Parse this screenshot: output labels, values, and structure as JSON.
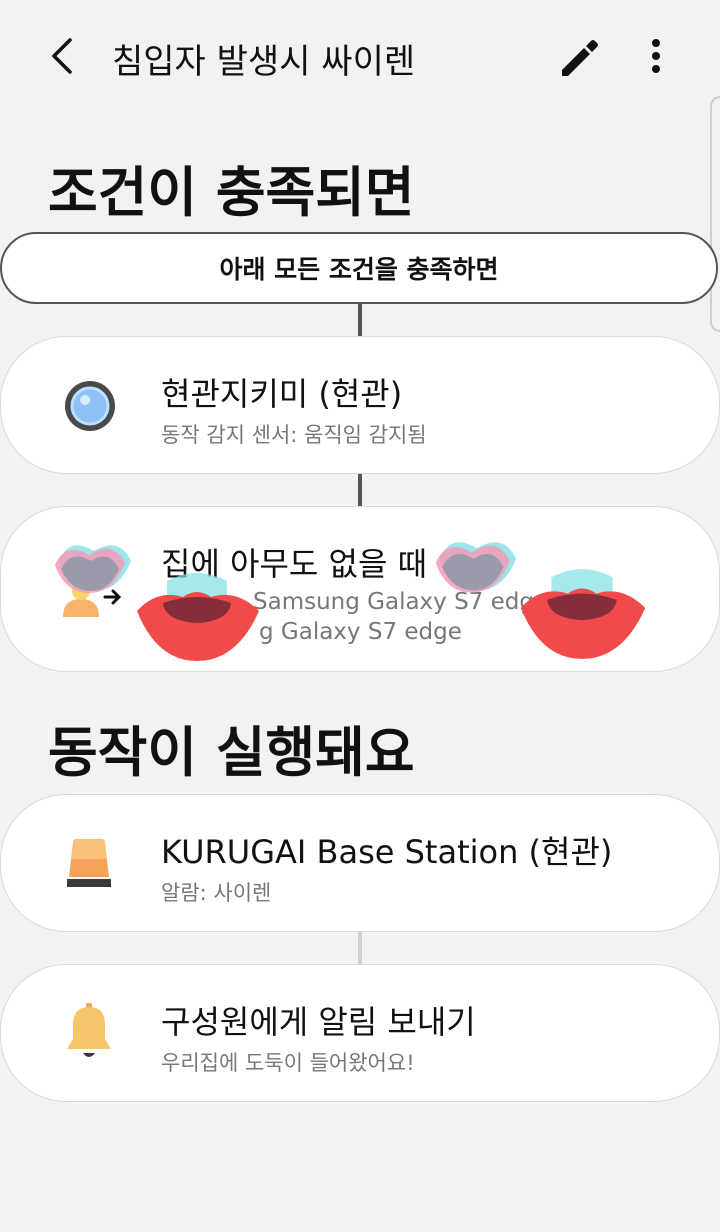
{
  "header": {
    "title": "침입자 발생시 싸이렌",
    "back_icon": "chevron-left-icon",
    "edit_icon": "pencil-icon",
    "more_icon": "more-vertical-icon"
  },
  "conditions": {
    "heading": "조건이 충족되면",
    "match_mode": "아래 모든 조건을 충족하면",
    "items": [
      {
        "title": "현관지키미 (현관)",
        "subtitle": "동작 감지 센서: 움직임 감지됨",
        "icon": "motion-sensor-icon"
      },
      {
        "title": "집에 아무도 없을 때",
        "subtitle_1": "Samsung Galaxy S7 edge",
        "subtitle_2": "g Galaxy S7 edge",
        "icon": "away-presence-icon"
      }
    ]
  },
  "actions": {
    "heading": "동작이 실행돼요",
    "items": [
      {
        "title": "KURUGAI Base Station (현관)",
        "subtitle": "알람: 사이렌",
        "icon": "siren-icon",
        "accent": "#f5a25a"
      },
      {
        "title": "구성원에게 알림 보내기",
        "subtitle": "우리집에 도둑이 들어왔어요!",
        "icon": "bell-icon",
        "accent": "#f7c66a"
      }
    ]
  }
}
